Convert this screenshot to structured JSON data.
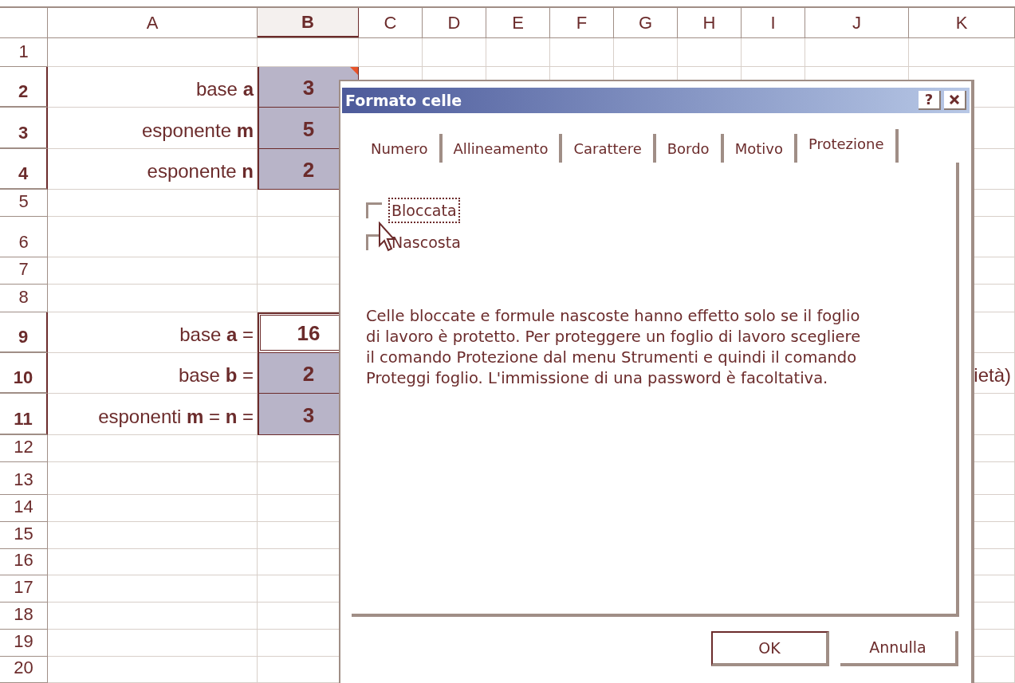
{
  "sheet": {
    "columns": [
      {
        "label": "A",
        "selected": false
      },
      {
        "label": "B",
        "selected": true
      },
      {
        "label": "C",
        "selected": false
      },
      {
        "label": "D",
        "selected": false
      },
      {
        "label": "E",
        "selected": false
      },
      {
        "label": "F",
        "selected": false
      },
      {
        "label": "G",
        "selected": false
      },
      {
        "label": "H",
        "selected": false
      },
      {
        "label": "I",
        "selected": false
      },
      {
        "label": "J",
        "selected": false
      },
      {
        "label": "K",
        "selected": false
      }
    ],
    "rows": [
      {
        "label": "1",
        "selected": false
      },
      {
        "label": "2",
        "selected": true,
        "a": "base **a**",
        "b": {
          "value": "3",
          "shaded": true,
          "has_comment": true
        }
      },
      {
        "label": "3",
        "selected": true,
        "a": "esponente **m**",
        "b": {
          "value": "5",
          "shaded": true
        }
      },
      {
        "label": "4",
        "selected": true,
        "a": "esponente **n**",
        "b": {
          "value": "2",
          "shaded": true
        }
      },
      {
        "label": "5",
        "selected": false
      },
      {
        "label": "6",
        "selected": false
      },
      {
        "label": "7",
        "selected": false
      },
      {
        "label": "8",
        "selected": false
      },
      {
        "label": "9",
        "selected": true,
        "a": "base **a** =",
        "b": {
          "value": "16",
          "shaded": false
        }
      },
      {
        "label": "10",
        "selected": true,
        "a": "base **b** =",
        "b": {
          "value": "2",
          "shaded": true
        },
        "k": "ietà)"
      },
      {
        "label": "11",
        "selected": true,
        "a": "esponenti **m** = **n** =",
        "b": {
          "value": "3",
          "shaded": true
        }
      },
      {
        "label": "12",
        "selected": false
      },
      {
        "label": "13",
        "selected": false
      },
      {
        "label": "14",
        "selected": false
      },
      {
        "label": "15",
        "selected": false
      },
      {
        "label": "16",
        "selected": false
      },
      {
        "label": "17",
        "selected": false
      },
      {
        "label": "18",
        "selected": false
      },
      {
        "label": "19",
        "selected": false
      },
      {
        "label": "20",
        "selected": false
      }
    ]
  },
  "dialog": {
    "title": "Formato celle",
    "help_button": "?",
    "tabs": [
      {
        "label": "Numero",
        "selected": false
      },
      {
        "label": "Allineamento",
        "selected": false
      },
      {
        "label": "Carattere",
        "selected": false
      },
      {
        "label": "Bordo",
        "selected": false
      },
      {
        "label": "Motivo",
        "selected": false
      },
      {
        "label": "Protezione",
        "selected": true
      }
    ],
    "checkboxes": [
      {
        "label": "Bloccata",
        "checked": false,
        "focused": true
      },
      {
        "label": "Nascosta",
        "checked": false,
        "focused": false
      }
    ],
    "description": "Celle bloccate e formule nascoste hanno effetto solo se il foglio di lavoro è protetto. Per proteggere un foglio di lavoro scegliere il comando Protezione dal menu Strumenti e quindi il comando Proteggi foglio. L'immissione di una password è facoltativa.",
    "buttons": [
      {
        "label": "OK",
        "default": true
      },
      {
        "label": "Annulla",
        "default": false
      }
    ]
  }
}
